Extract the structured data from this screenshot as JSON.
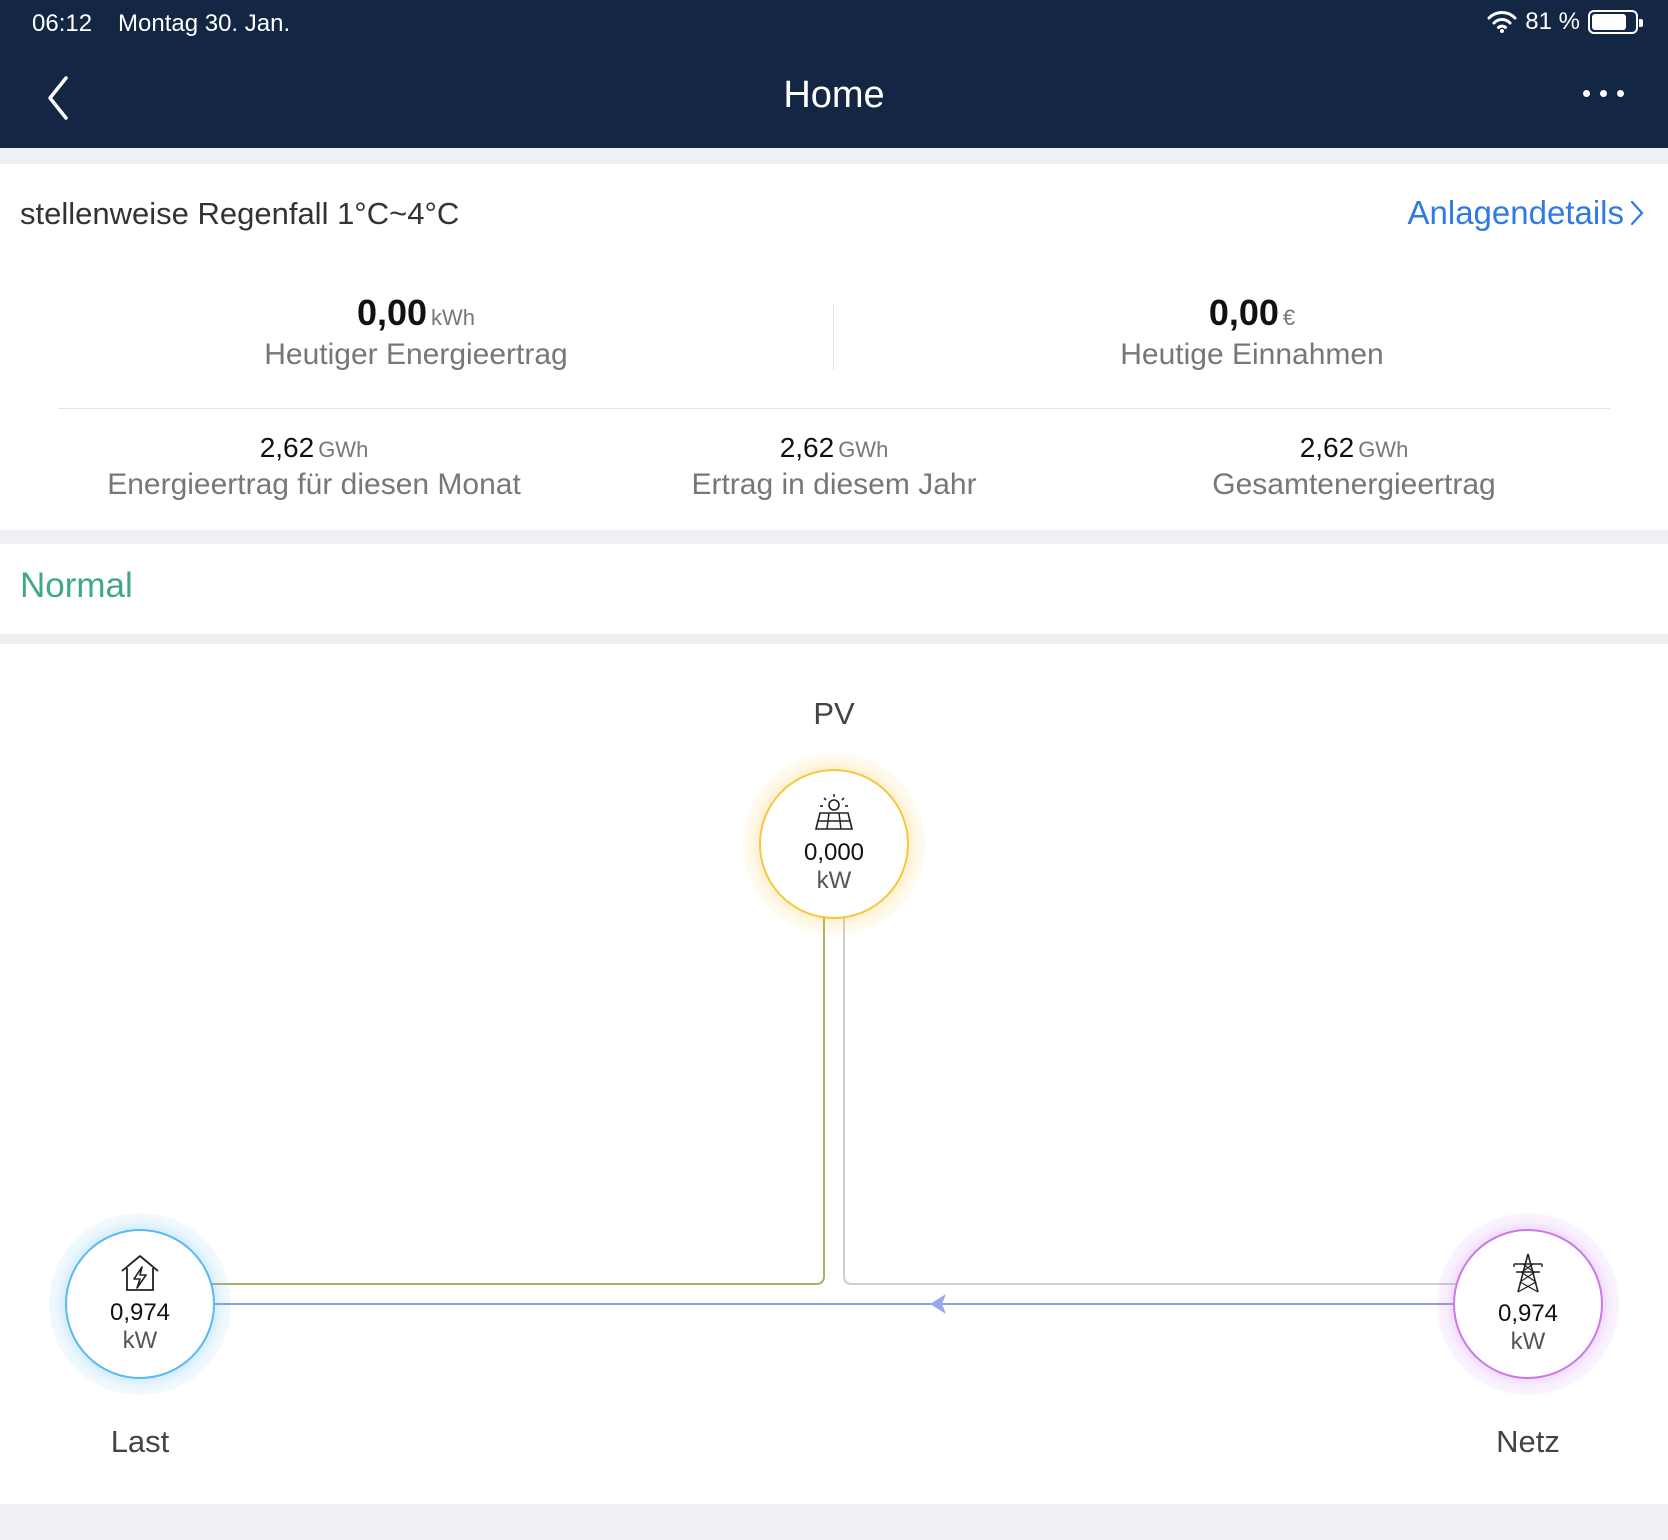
{
  "status_bar": {
    "time": "06:12",
    "date": "Montag 30. Jan.",
    "battery": "81 %",
    "battery_level": 0.81
  },
  "nav": {
    "title": "Home"
  },
  "overview": {
    "weather": "stellenweise Regenfall 1°C~4°C",
    "details_link": "Anlagendetails",
    "today_yield": {
      "value": "0,00",
      "unit": "kWh",
      "label": "Heutiger Energieertrag"
    },
    "today_revenue": {
      "value": "0,00",
      "unit": "€",
      "label": "Heutige Einnahmen"
    },
    "month_yield": {
      "value": "2,62",
      "unit": "GWh",
      "label": "Energieertrag für diesen Monat"
    },
    "year_yield": {
      "value": "2,62",
      "unit": "GWh",
      "label": "Ertrag in diesem Jahr"
    },
    "total_yield": {
      "value": "2,62",
      "unit": "GWh",
      "label": "Gesamtenergieertrag"
    }
  },
  "plant_status": {
    "text": "Normal",
    "color": "#3daa7f"
  },
  "energy_flow": {
    "pv": {
      "label": "PV",
      "value": "0,000",
      "unit": "kW",
      "icon": "solar-panel-icon",
      "color": "#f5c842"
    },
    "load": {
      "label": "Last",
      "value": "0,974",
      "unit": "kW",
      "icon": "house-lightning-icon",
      "color": "#5bb8f0"
    },
    "grid": {
      "label": "Netz",
      "value": "0,974",
      "unit": "kW",
      "icon": "power-tower-icon",
      "color": "#c77be8"
    }
  }
}
